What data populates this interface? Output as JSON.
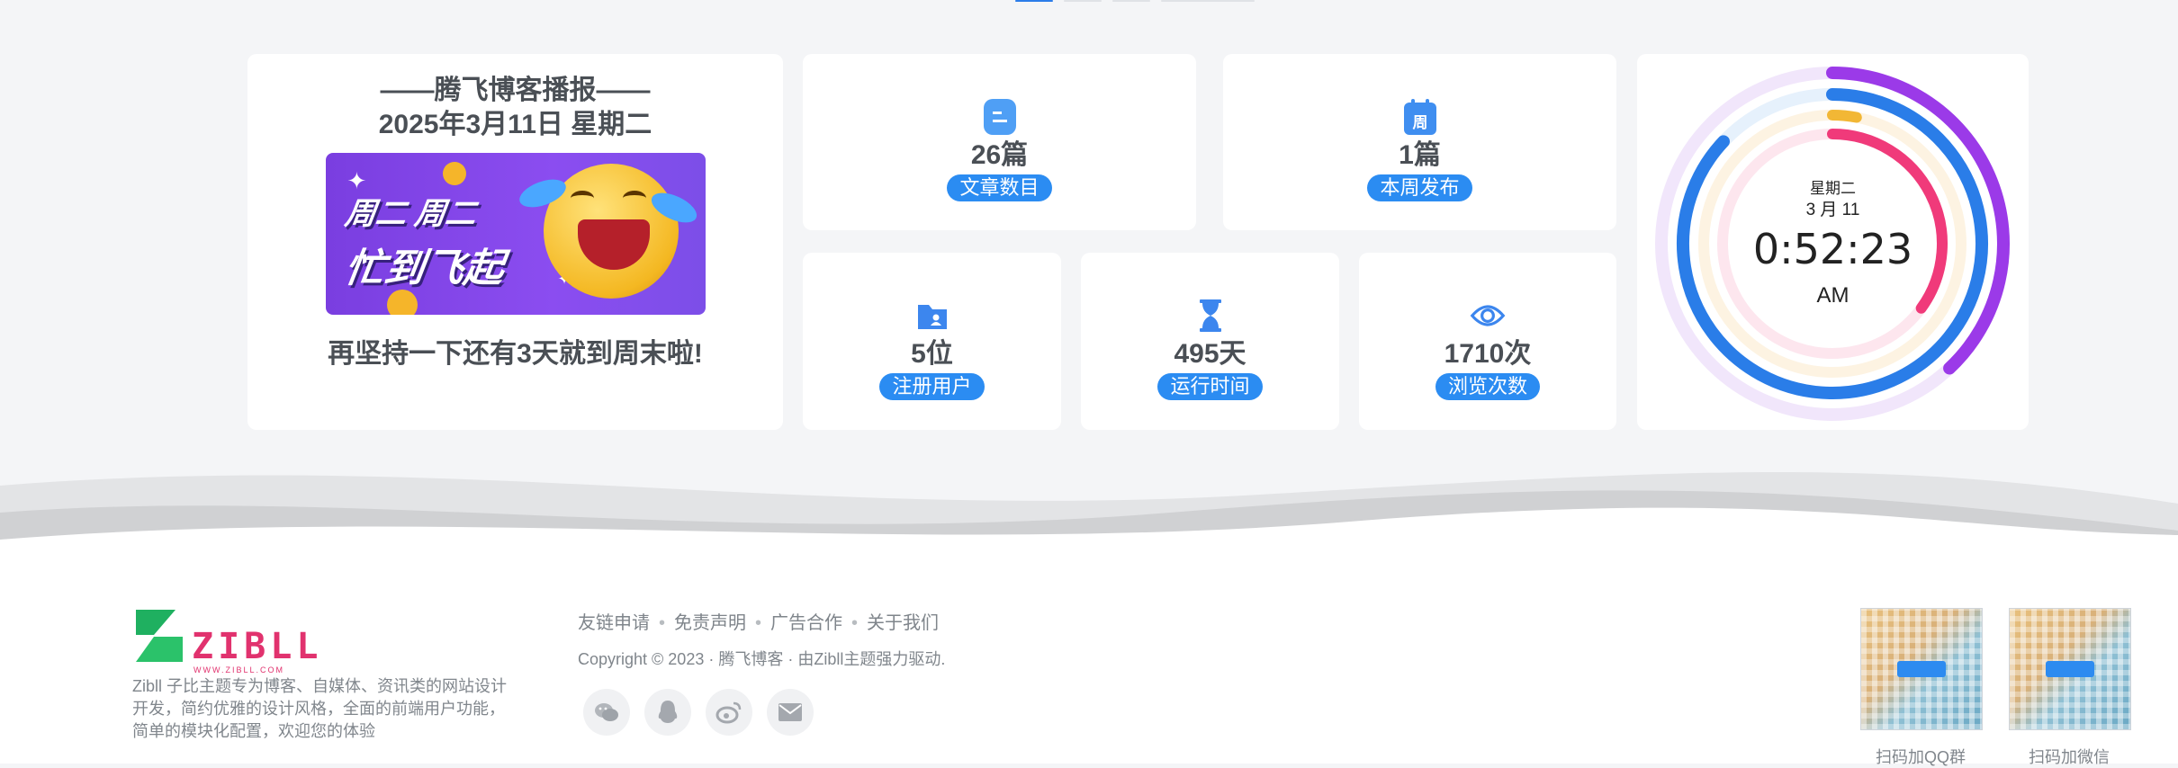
{
  "daily": {
    "title": "——腾飞博客播报——",
    "date": "2025年3月11日 星期二",
    "banner_line1": "周二 周二",
    "banner_line2": "忙到飞起",
    "footer": "再坚持一下还有3天就到周末啦!"
  },
  "stats": {
    "posts": {
      "value": "26篇",
      "label": "文章数目",
      "icon": "document-icon"
    },
    "week": {
      "value": "1篇",
      "label": "本周发布",
      "icon": "calendar-week-icon",
      "icon_text": "周"
    },
    "users": {
      "value": "5位",
      "label": "注册用户",
      "icon": "user-folder-icon"
    },
    "uptime": {
      "value": "495天",
      "label": "运行时间",
      "icon": "hourglass-icon"
    },
    "views": {
      "value": "1710次",
      "label": "浏览次数",
      "icon": "eye-icon"
    }
  },
  "clock": {
    "weekday": "星期二",
    "date": "3 月 11",
    "time": "0:52:23",
    "ampm": "AM",
    "ring_colors": [
      "#9b3ae8",
      "#2a7de8",
      "#f2b735",
      "#f03a7a"
    ],
    "progress": {
      "seconds": 0.38,
      "minutes": 0.87,
      "hours": 0.03,
      "day": 0.35
    }
  },
  "footer": {
    "logo_word": "ZIBLL",
    "logo_url": "WWW.ZIBLL.COM",
    "about": "Zibll 子比主题专为博客、自媒体、资讯类的网站设计开发，简约优雅的设计风格，全面的前端用户功能，简单的模块化配置，欢迎您的体验",
    "links": [
      "友链申请",
      "免责声明",
      "广告合作",
      "关于我们"
    ],
    "copyright": "Copyright © 2023 · 腾飞博客 · 由Zibll主题强力驱动.",
    "social": [
      "wechat-icon",
      "qq-icon",
      "weibo-icon",
      "mail-icon"
    ],
    "qr_qq_caption": "扫码加QQ群",
    "qr_wx_caption": "扫码加微信"
  },
  "colors": {
    "accent": "#2b8cf2",
    "brand": "#e1326e"
  }
}
